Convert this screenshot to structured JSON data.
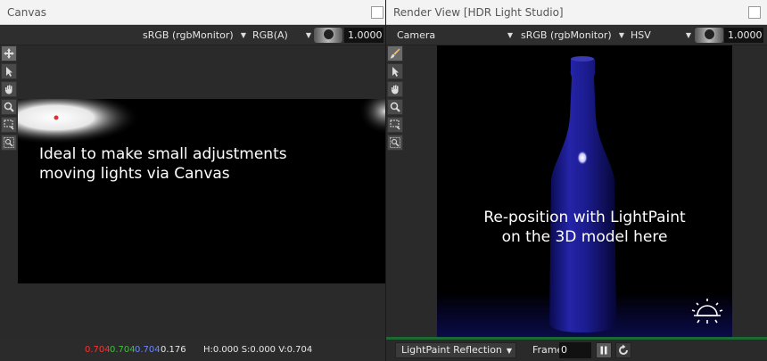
{
  "canvas_panel": {
    "title": "Canvas",
    "toolbar": {
      "colorspace": "sRGB (rgbMonitor)",
      "channel": "RGB(A)",
      "exposure": "1.0000"
    },
    "tools": [
      "move-icon",
      "pointer-icon",
      "hand-icon",
      "zoom-icon",
      "region-icon",
      "zoom-region-icon"
    ],
    "overlay_text": [
      "Ideal to make small adjustments",
      "moving lights via Canvas"
    ],
    "status": {
      "r": "0.704",
      "g": "0.704",
      "b": "0.704",
      "a": "0.176",
      "hsv": "H:0.000 S:0.000 V:0.704"
    }
  },
  "render_panel": {
    "title": "Render View [HDR Light Studio]",
    "toolbar": {
      "camera": "Camera",
      "colorspace": "sRGB (rgbMonitor)",
      "channel": "HSV",
      "exposure": "1.0000"
    },
    "tools": [
      "paint-brush-icon",
      "pointer-icon",
      "hand-icon",
      "zoom-icon",
      "region-icon",
      "zoom-region-icon"
    ],
    "overlay_text": [
      "Re-position with LightPaint",
      "on the 3D model here"
    ],
    "bottom": {
      "mode": "LightPaint Reflection",
      "frame_label": "Frame",
      "frame_value": "0"
    }
  },
  "colors": {
    "red": "#ff3030",
    "green": "#3fbf3f",
    "blue": "#4a6cff",
    "progress_green": "#1b6a32",
    "bottle_blue": "#1a1a8c"
  }
}
